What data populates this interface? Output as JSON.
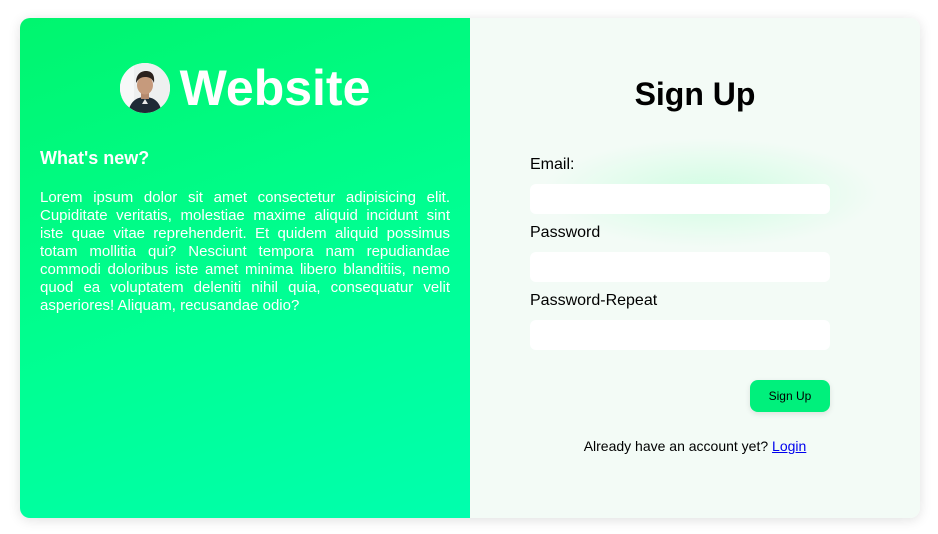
{
  "brand": {
    "name": "Website",
    "avatar_icon": "profile-photo"
  },
  "news": {
    "title": "What's new?",
    "body": "Lorem ipsum dolor sit amet consectetur adipisicing elit. Cupiditate veritatis, molestiae maxime aliquid incidunt sint iste quae vitae reprehenderit. Et quidem aliquid possimus totam mollitia qui? Nesciunt tempora nam repudiandae commodi doloribus iste amet minima libero blanditiis, nemo quod ea voluptatem deleniti nihil quia, consequatur velit asperiores! Aliquam, recusandae odio?"
  },
  "form": {
    "title": "Sign Up",
    "email_label": "Email:",
    "email_value": "",
    "password_label": "Password",
    "password_value": "",
    "password_repeat_label": "Password-Repeat",
    "password_repeat_value": "",
    "submit_label": "Sign Up",
    "login_prompt": "Already have an account yet?",
    "login_link": "Login"
  },
  "colors": {
    "left_panel_gradient_start": "#00f56e",
    "left_panel_gradient_end": "#00ffae",
    "right_panel_bg": "#f3fbf6",
    "button_bg": "#00f07c",
    "link": "#0000ee"
  }
}
